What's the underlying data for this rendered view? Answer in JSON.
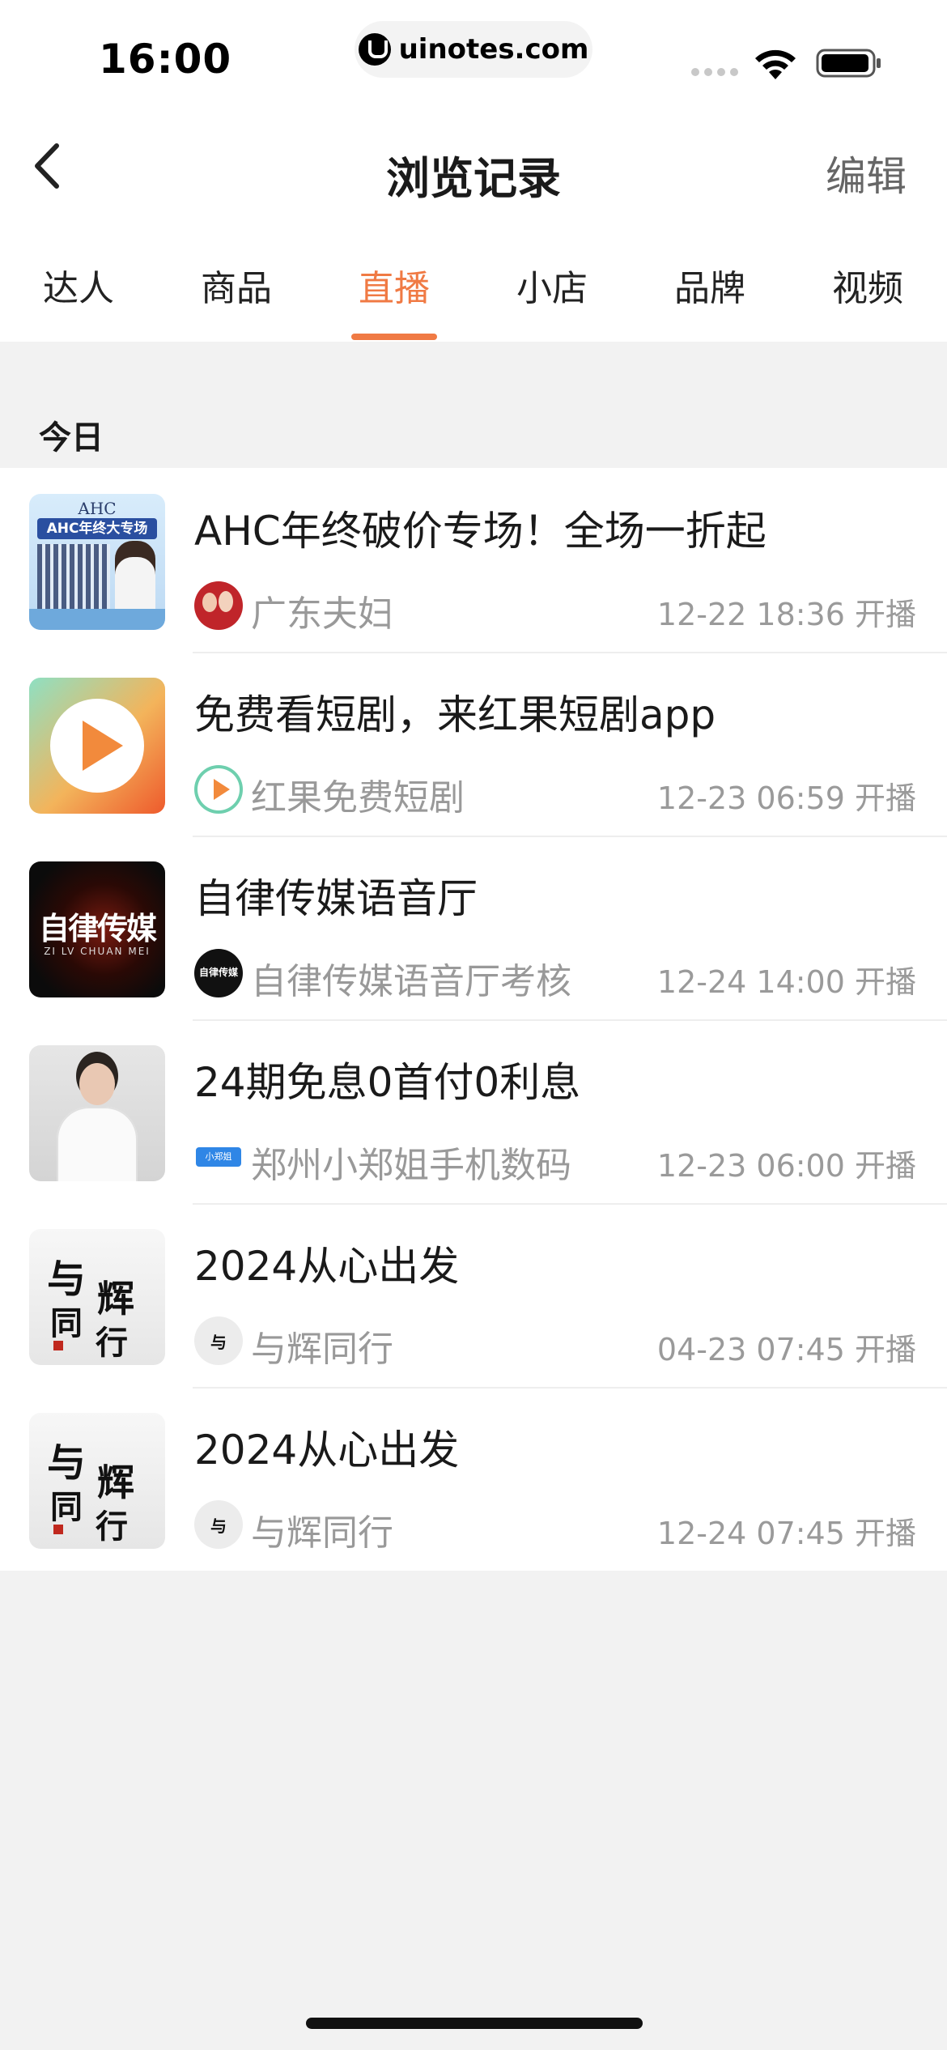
{
  "status_bar": {
    "time": "16:00",
    "url": "uinotes.com"
  },
  "nav": {
    "title": "浏览记录",
    "edit_label": "编辑"
  },
  "tabs": [
    {
      "label": "达人"
    },
    {
      "label": "商品"
    },
    {
      "label": "直播",
      "active": true
    },
    {
      "label": "小店"
    },
    {
      "label": "品牌"
    },
    {
      "label": "视频"
    }
  ],
  "section": {
    "header": "今日"
  },
  "items": [
    {
      "title": "AHC年终破价专场！全场一折起",
      "anchor": "广东夫妇",
      "time": "12-22 18:36 开播",
      "thumb_label_top": "AHC",
      "thumb_label_banner": "AHC年终大专场"
    },
    {
      "title": "免费看短剧，来红果短剧app",
      "anchor": "红果免费短剧",
      "time": "12-23 06:59 开播"
    },
    {
      "title": "自律传媒语音厅",
      "anchor": "自律传媒语音厅考核",
      "time": "12-24 14:00 开播",
      "thumb_label": "自律传媒",
      "thumb_sub": "ZI LV CHUAN MEI",
      "avatar_label": "自律传媒"
    },
    {
      "title": "24期免息0首付0利息",
      "anchor": "郑州小郑姐手机数码",
      "time": "12-23 06:00 开播",
      "avatar_label": "小郑姐"
    },
    {
      "title": "2024从心出发",
      "anchor": "与辉同行",
      "time": "04-23 07:45 开播",
      "thumb_chars": [
        "与",
        "辉",
        "同",
        "行"
      ]
    },
    {
      "title": "2024从心出发",
      "anchor": "与辉同行",
      "time": "12-24 07:45 开播",
      "thumb_chars": [
        "与",
        "辉",
        "同",
        "行"
      ]
    }
  ],
  "colors": {
    "accent": "#f07a44",
    "background": "#f2f2f2",
    "muted_text": "#999999"
  }
}
